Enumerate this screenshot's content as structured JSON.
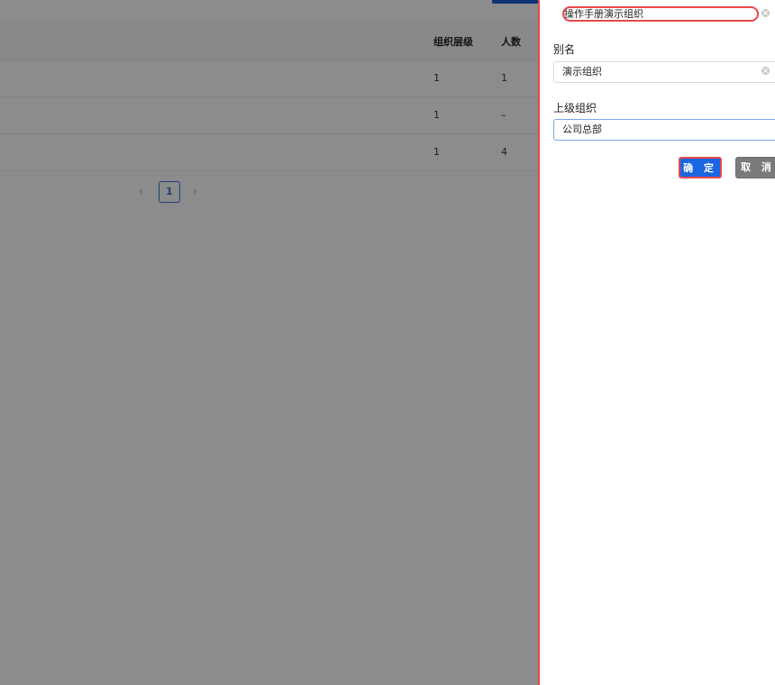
{
  "background_table": {
    "columns": [
      "组织层级",
      "人数"
    ],
    "rows": [
      {
        "level": "1",
        "count": "1"
      },
      {
        "level": "1",
        "count": "–"
      },
      {
        "level": "1",
        "count": "4"
      }
    ]
  },
  "pagination": {
    "prev": "‹",
    "current": "1",
    "next": "›"
  },
  "drawer": {
    "name_value": "操作手册演示组织",
    "alias_label": "别名",
    "alias_value": "演示组织",
    "parent_label": "上级组织",
    "parent_value": "公司总部",
    "confirm_label": "确 定",
    "cancel_label": "取 消"
  }
}
